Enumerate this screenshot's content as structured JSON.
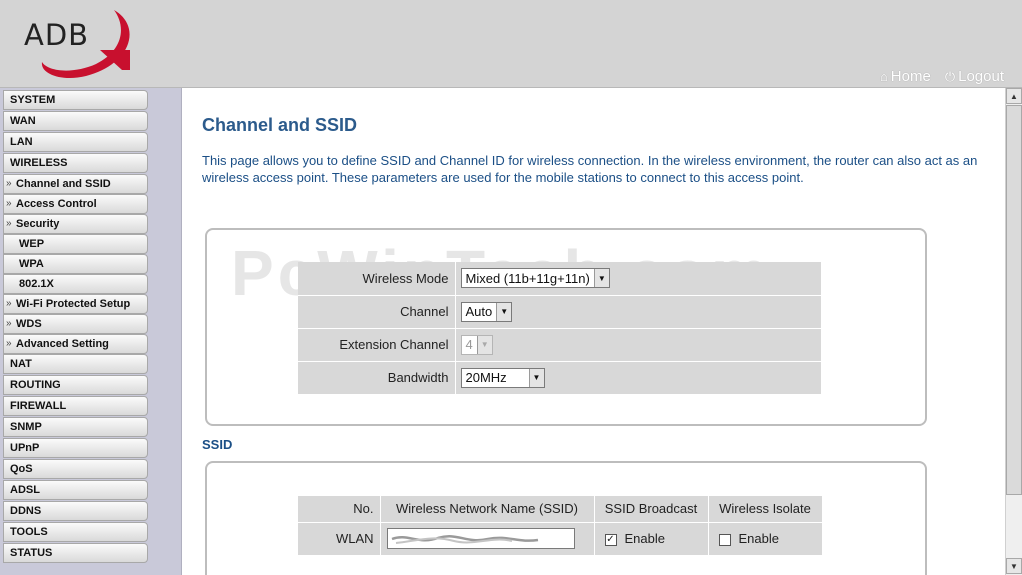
{
  "header": {
    "logo_text": "ADB",
    "home_label": "Home",
    "logout_label": "Logout",
    "home_icon": "house-icon",
    "logout_icon": "power-icon",
    "logo_accent_color": "#c8102e"
  },
  "sidebar": {
    "items": [
      {
        "label": "SYSTEM"
      },
      {
        "label": "WAN"
      },
      {
        "label": "LAN"
      },
      {
        "label": "WIRELESS"
      },
      {
        "label": "Channel and SSID"
      },
      {
        "label": "Access Control"
      },
      {
        "label": "Security"
      },
      {
        "label": "WEP"
      },
      {
        "label": "WPA"
      },
      {
        "label": "802.1X"
      },
      {
        "label": "Wi-Fi Protected Setup"
      },
      {
        "label": "WDS"
      },
      {
        "label": "Advanced Setting"
      },
      {
        "label": "NAT"
      },
      {
        "label": "ROUTING"
      },
      {
        "label": "FIREWALL"
      },
      {
        "label": "SNMP"
      },
      {
        "label": "UPnP"
      },
      {
        "label": "QoS"
      },
      {
        "label": "ADSL"
      },
      {
        "label": "DDNS"
      },
      {
        "label": "TOOLS"
      },
      {
        "label": "STATUS"
      }
    ],
    "arrow_glyph": "»"
  },
  "main": {
    "title": "Channel and SSID",
    "description": "This page allows you to define SSID and Channel ID for wireless connection.  In the wireless environment, the router can also act as an wireless access point.  These parameters are used for the mobile stations to connect to this access point.",
    "watermark": "PcWinTech.com",
    "wireless": {
      "mode_label": "Wireless Mode",
      "mode_value": "Mixed (11b+11g+11n)",
      "channel_label": "Channel",
      "channel_value": "Auto",
      "ext_channel_label": "Extension Channel",
      "ext_channel_value": "4",
      "bandwidth_label": "Bandwidth",
      "bandwidth_value": "20MHz"
    },
    "ssid": {
      "heading": "SSID",
      "col_no": "No.",
      "col_name": "Wireless Network Name (SSID)",
      "col_broadcast": "SSID Broadcast",
      "col_isolate": "Wireless Isolate",
      "row_label": "WLAN",
      "broadcast_checked": true,
      "broadcast_label": "Enable",
      "isolate_checked": false,
      "isolate_label": "Enable"
    }
  }
}
